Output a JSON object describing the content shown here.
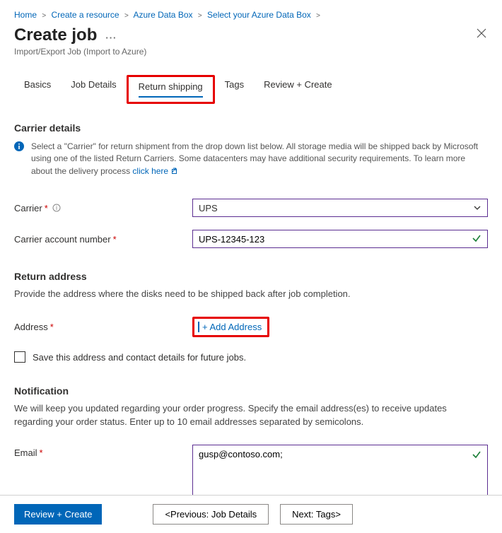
{
  "breadcrumb": {
    "items": [
      "Home",
      "Create a resource",
      "Azure Data Box",
      "Select your Azure Data Box"
    ]
  },
  "header": {
    "title": "Create job",
    "subtitle": "Import/Export Job (Import to Azure)"
  },
  "tabs": {
    "basics": "Basics",
    "job_details": "Job Details",
    "return_shipping": "Return shipping",
    "tags": "Tags",
    "review": "Review + Create"
  },
  "carrier_section": {
    "title": "Carrier details",
    "info_text": "Select a \"Carrier\" for return shipment from the drop down list below. All storage media will be shipped back by Microsoft using one of the listed Return Carriers. Some datacenters may have additional security requirements. To learn more about the delivery process ",
    "info_link": "click here",
    "carrier_label": "Carrier",
    "carrier_value": "UPS",
    "account_label": "Carrier account number",
    "account_value": "UPS-12345-123"
  },
  "return_address": {
    "title": "Return address",
    "desc": "Provide the address where the disks need to be shipped back after job completion.",
    "address_label": "Address",
    "add_address": "+ Add Address",
    "save_label": "Save this address and contact details for future jobs."
  },
  "notification": {
    "title": "Notification",
    "desc": "We will keep you updated regarding your order progress. Specify the email address(es) to receive updates regarding your order status. Enter up to 10 email addresses separated by semicolons.",
    "email_label": "Email",
    "email_value": "gusp@contoso.com;"
  },
  "footer": {
    "review": "Review + Create",
    "prev": "<Previous: Job Details",
    "next": "Next: Tags>"
  }
}
